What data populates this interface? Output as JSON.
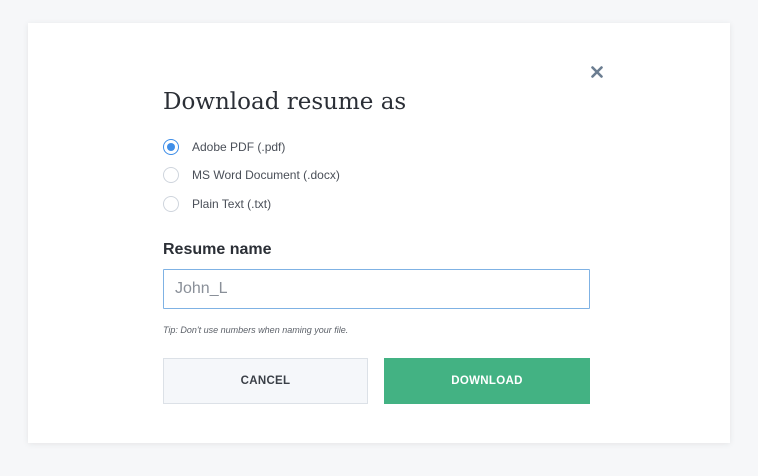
{
  "dialog": {
    "title": "Download resume as",
    "formats": [
      {
        "label": "Adobe PDF (.pdf)",
        "checked": true
      },
      {
        "label": "MS Word Document (.docx)",
        "checked": false
      },
      {
        "label": "Plain Text (.txt)",
        "checked": false
      }
    ],
    "name_label": "Resume name",
    "name_value": "John_L",
    "tip": "Tip: Don't use numbers when naming your file.",
    "cancel_label": "CANCEL",
    "download_label": "DOWNLOAD"
  },
  "colors": {
    "accent_blue": "#3f8ee8",
    "download_green": "#43b283",
    "close_icon": "#6b7d91"
  },
  "icons": {
    "close": "close-icon"
  }
}
